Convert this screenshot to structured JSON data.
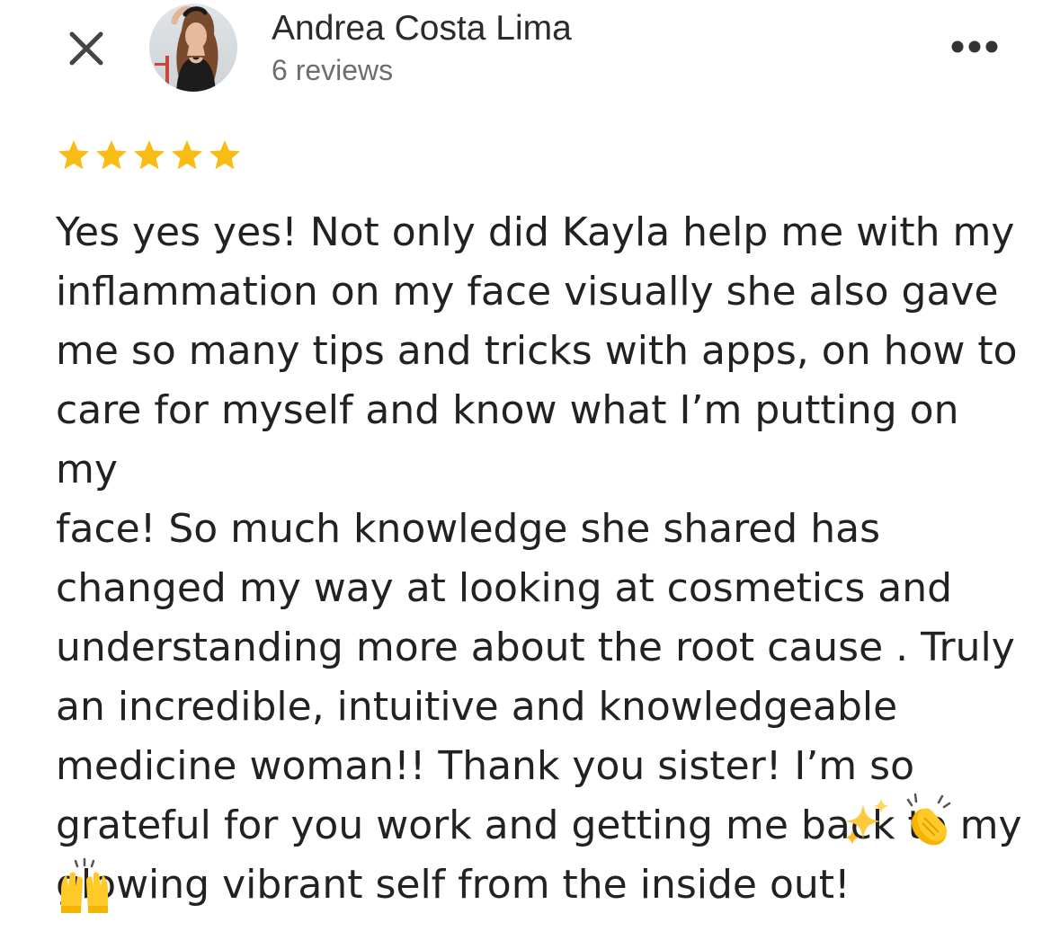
{
  "header": {
    "close_icon": "close-icon",
    "reviewer_name": "Andrea Costa Lima",
    "review_count": "6 reviews",
    "more_icon": "more-horizontal-icon"
  },
  "review": {
    "rating": 5,
    "max_rating": 5,
    "star_color": "#F9BC15",
    "text_lines": [
      "Yes yes yes! Not only did Kayla help me with my",
      "inflammation on my face visually she also gave",
      "me so many tips and tricks with apps, on how to",
      "care for myself and know what I’m putting on my",
      "face! So much knowledge she shared has",
      "changed my way at looking at cosmetics and",
      "understanding more about the root cause . Truly",
      "an incredible, intuitive and knowledgeable",
      "medicine woman!! Thank you sister! I’m so",
      "grateful for you work and getting me back to my",
      "glowing vibrant self from the inside out!"
    ],
    "emojis": [
      "sparkles",
      "clapping-hands",
      "raising-hands"
    ]
  }
}
